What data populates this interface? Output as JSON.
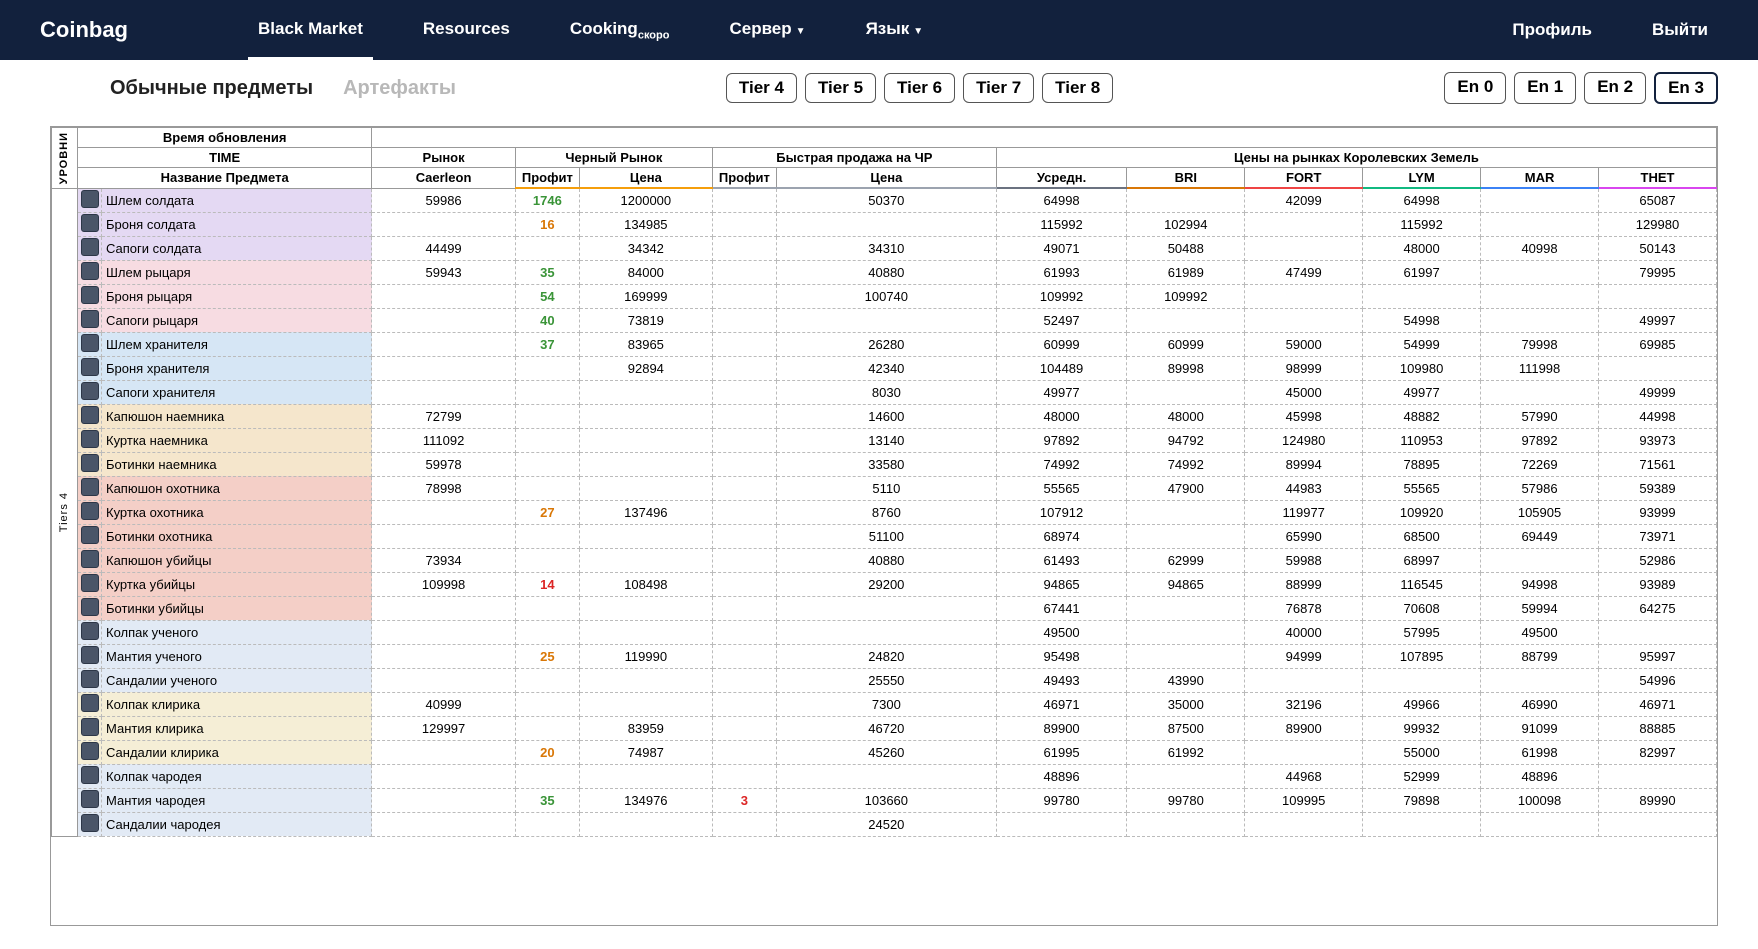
{
  "brand": "Coinbag",
  "nav": [
    "Black Market",
    "Resources",
    "Cooking",
    "Сервер",
    "Язык"
  ],
  "nav_cooking_suffix": "скоро",
  "nav_right": [
    "Профиль",
    "Выйти"
  ],
  "tabs": {
    "regular": "Обычные предметы",
    "artifacts": "Артефакты"
  },
  "tiers": [
    "Tier 4",
    "Tier 5",
    "Tier 6",
    "Tier 7",
    "Tier 8"
  ],
  "enchants": [
    "En 0",
    "En 1",
    "En 2",
    "En 3"
  ],
  "headers": {
    "levels": "УРОВНИ",
    "update_time": "Время обновления",
    "time": "TIME",
    "market": "Рынок",
    "black_market": "Черный Рынок",
    "quick_sell": "Быстрая продажа на ЧР",
    "royal_prices": "Цены на рынках Королевских Земель",
    "item_name": "Название Предмета",
    "caerleon": "Caerleon",
    "profit": "Профит",
    "price": "Цена",
    "avg": "Усредн.",
    "bri": "BRI",
    "fort": "FORT",
    "lym": "LYM",
    "mar": "MAR",
    "thet": "THET"
  },
  "tier_label": "Tiers 4",
  "rows": [
    {
      "name": "Шлем солдата",
      "bg": "bg-lav",
      "caer": "59986",
      "bm_p": "1746",
      "bm_pc": "pr-green",
      "bm_pr": "1200000",
      "qs_p": "",
      "qs_pr": "50370",
      "avg": "64998",
      "bri": "",
      "fort": "42099",
      "lym": "64998",
      "mar": "",
      "thet": "65087"
    },
    {
      "name": "Броня солдата",
      "bg": "bg-lav",
      "caer": "",
      "bm_p": "16",
      "bm_pc": "pr-orange",
      "bm_pr": "134985",
      "qs_p": "",
      "qs_pr": "",
      "avg": "115992",
      "bri": "102994",
      "fort": "",
      "lym": "115992",
      "mar": "",
      "thet": "129980"
    },
    {
      "name": "Сапоги солдата",
      "bg": "bg-lav",
      "caer": "44499",
      "bm_p": "",
      "bm_pc": "",
      "bm_pr": "34342",
      "qs_p": "",
      "qs_pr": "34310",
      "avg": "49071",
      "bri": "50488",
      "fort": "",
      "lym": "48000",
      "mar": "40998",
      "thet": "50143"
    },
    {
      "name": "Шлем рыцаря",
      "bg": "bg-pink",
      "caer": "59943",
      "bm_p": "35",
      "bm_pc": "pr-green",
      "bm_pr": "84000",
      "qs_p": "",
      "qs_pr": "40880",
      "avg": "61993",
      "bri": "61989",
      "fort": "47499",
      "lym": "61997",
      "mar": "",
      "thet": "79995"
    },
    {
      "name": "Броня рыцаря",
      "bg": "bg-pink",
      "caer": "",
      "bm_p": "54",
      "bm_pc": "pr-green",
      "bm_pr": "169999",
      "qs_p": "",
      "qs_pr": "100740",
      "avg": "109992",
      "bri": "109992",
      "fort": "",
      "lym": "",
      "mar": "",
      "thet": ""
    },
    {
      "name": "Сапоги рыцаря",
      "bg": "bg-pink",
      "caer": "",
      "bm_p": "40",
      "bm_pc": "pr-green",
      "bm_pr": "73819",
      "qs_p": "",
      "qs_pr": "",
      "avg": "52497",
      "bri": "",
      "fort": "",
      "lym": "54998",
      "mar": "",
      "thet": "49997"
    },
    {
      "name": "Шлем хранителя",
      "bg": "bg-blue",
      "caer": "",
      "bm_p": "37",
      "bm_pc": "pr-green",
      "bm_pr": "83965",
      "qs_p": "",
      "qs_pr": "26280",
      "avg": "60999",
      "bri": "60999",
      "fort": "59000",
      "lym": "54999",
      "mar": "79998",
      "thet": "69985"
    },
    {
      "name": "Броня хранителя",
      "bg": "bg-blue",
      "caer": "",
      "bm_p": "",
      "bm_pc": "",
      "bm_pr": "92894",
      "qs_p": "",
      "qs_pr": "42340",
      "avg": "104489",
      "bri": "89998",
      "fort": "98999",
      "lym": "109980",
      "mar": "111998",
      "thet": ""
    },
    {
      "name": "Сапоги хранителя",
      "bg": "bg-blue",
      "caer": "",
      "bm_p": "",
      "bm_pc": "",
      "bm_pr": "",
      "qs_p": "",
      "qs_pr": "8030",
      "avg": "49977",
      "bri": "",
      "fort": "45000",
      "lym": "49977",
      "mar": "",
      "thet": "49999"
    },
    {
      "name": "Капюшон наемника",
      "bg": "bg-tan",
      "caer": "72799",
      "bm_p": "",
      "bm_pc": "",
      "bm_pr": "",
      "qs_p": "",
      "qs_pr": "14600",
      "avg": "48000",
      "bri": "48000",
      "fort": "45998",
      "lym": "48882",
      "mar": "57990",
      "thet": "44998"
    },
    {
      "name": "Куртка наемника",
      "bg": "bg-tan",
      "caer": "111092",
      "bm_p": "",
      "bm_pc": "",
      "bm_pr": "",
      "qs_p": "",
      "qs_pr": "13140",
      "avg": "97892",
      "bri": "94792",
      "fort": "124980",
      "lym": "110953",
      "mar": "97892",
      "thet": "93973"
    },
    {
      "name": "Ботинки наемника",
      "bg": "bg-tan",
      "caer": "59978",
      "bm_p": "",
      "bm_pc": "",
      "bm_pr": "",
      "qs_p": "",
      "qs_pr": "33580",
      "avg": "74992",
      "bri": "74992",
      "fort": "89994",
      "lym": "78895",
      "mar": "72269",
      "thet": "71561"
    },
    {
      "name": "Капюшон охотника",
      "bg": "bg-red",
      "caer": "78998",
      "bm_p": "",
      "bm_pc": "",
      "bm_pr": "",
      "qs_p": "",
      "qs_pr": "5110",
      "avg": "55565",
      "bri": "47900",
      "fort": "44983",
      "lym": "55565",
      "mar": "57986",
      "thet": "59389"
    },
    {
      "name": "Куртка охотника",
      "bg": "bg-red",
      "caer": "",
      "bm_p": "27",
      "bm_pc": "pr-orange",
      "bm_pr": "137496",
      "qs_p": "",
      "qs_pr": "8760",
      "avg": "107912",
      "bri": "",
      "fort": "119977",
      "lym": "109920",
      "mar": "105905",
      "thet": "93999"
    },
    {
      "name": "Ботинки охотника",
      "bg": "bg-red",
      "caer": "",
      "bm_p": "",
      "bm_pc": "",
      "bm_pr": "",
      "qs_p": "",
      "qs_pr": "51100",
      "avg": "68974",
      "bri": "",
      "fort": "65990",
      "lym": "68500",
      "mar": "69449",
      "thet": "73971"
    },
    {
      "name": "Капюшон убийцы",
      "bg": "bg-red",
      "caer": "73934",
      "bm_p": "",
      "bm_pc": "",
      "bm_pr": "",
      "qs_p": "",
      "qs_pr": "40880",
      "avg": "61493",
      "bri": "62999",
      "fort": "59988",
      "lym": "68997",
      "mar": "",
      "thet": "52986"
    },
    {
      "name": "Куртка убийцы",
      "bg": "bg-red",
      "caer": "109998",
      "bm_p": "14",
      "bm_pc": "pr-red",
      "bm_pr": "108498",
      "qs_p": "",
      "qs_pr": "29200",
      "avg": "94865",
      "bri": "94865",
      "fort": "88999",
      "lym": "116545",
      "mar": "94998",
      "thet": "93989"
    },
    {
      "name": "Ботинки убийцы",
      "bg": "bg-red",
      "caer": "",
      "bm_p": "",
      "bm_pc": "",
      "bm_pr": "",
      "qs_p": "",
      "qs_pr": "",
      "avg": "67441",
      "bri": "",
      "fort": "76878",
      "lym": "70608",
      "mar": "59994",
      "thet": "64275"
    },
    {
      "name": "Колпак ученого",
      "bg": "bg-lblue",
      "caer": "",
      "bm_p": "",
      "bm_pc": "",
      "bm_pr": "",
      "qs_p": "",
      "qs_pr": "",
      "avg": "49500",
      "bri": "",
      "fort": "40000",
      "lym": "57995",
      "mar": "49500",
      "thet": ""
    },
    {
      "name": "Мантия ученого",
      "bg": "bg-lblue",
      "caer": "",
      "bm_p": "25",
      "bm_pc": "pr-orange",
      "bm_pr": "119990",
      "qs_p": "",
      "qs_pr": "24820",
      "avg": "95498",
      "bri": "",
      "fort": "94999",
      "lym": "107895",
      "mar": "88799",
      "thet": "95997"
    },
    {
      "name": "Сандалии ученого",
      "bg": "bg-lblue",
      "caer": "",
      "bm_p": "",
      "bm_pc": "",
      "bm_pr": "",
      "qs_p": "",
      "qs_pr": "25550",
      "avg": "49493",
      "bri": "43990",
      "fort": "",
      "lym": "",
      "mar": "",
      "thet": "54996"
    },
    {
      "name": "Колпак клирика",
      "bg": "bg-cream",
      "caer": "40999",
      "bm_p": "",
      "bm_pc": "",
      "bm_pr": "",
      "qs_p": "",
      "qs_pr": "7300",
      "avg": "46971",
      "bri": "35000",
      "fort": "32196",
      "lym": "49966",
      "mar": "46990",
      "thet": "46971"
    },
    {
      "name": "Мантия клирика",
      "bg": "bg-cream",
      "caer": "129997",
      "bm_p": "",
      "bm_pc": "",
      "bm_pr": "83959",
      "qs_p": "",
      "qs_pr": "46720",
      "avg": "89900",
      "bri": "87500",
      "fort": "89900",
      "lym": "99932",
      "mar": "91099",
      "thet": "88885"
    },
    {
      "name": "Сандалии клирика",
      "bg": "bg-cream",
      "caer": "",
      "bm_p": "20",
      "bm_pc": "pr-orange",
      "bm_pr": "74987",
      "qs_p": "",
      "qs_pr": "45260",
      "avg": "61995",
      "bri": "61992",
      "fort": "",
      "lym": "55000",
      "mar": "61998",
      "thet": "82997"
    },
    {
      "name": "Колпак чародея",
      "bg": "bg-lblue",
      "caer": "",
      "bm_p": "",
      "bm_pc": "",
      "bm_pr": "",
      "qs_p": "",
      "qs_pr": "",
      "avg": "48896",
      "bri": "",
      "fort": "44968",
      "lym": "52999",
      "mar": "48896",
      "thet": ""
    },
    {
      "name": "Мантия чародея",
      "bg": "bg-lblue",
      "caer": "",
      "bm_p": "35",
      "bm_pc": "pr-green",
      "bm_pr": "134976",
      "qs_p": "3",
      "qs_pc": "pr-red",
      "qs_pr": "103660",
      "avg": "99780",
      "bri": "99780",
      "fort": "109995",
      "lym": "79898",
      "mar": "100098",
      "thet": "89990"
    },
    {
      "name": "Сандалии чародея",
      "bg": "bg-lblue",
      "caer": "",
      "bm_p": "",
      "bm_pc": "",
      "bm_pr": "",
      "qs_p": "",
      "qs_pr": "24520",
      "avg": "",
      "bri": "",
      "fort": "",
      "lym": "",
      "mar": "",
      "thet": ""
    }
  ]
}
